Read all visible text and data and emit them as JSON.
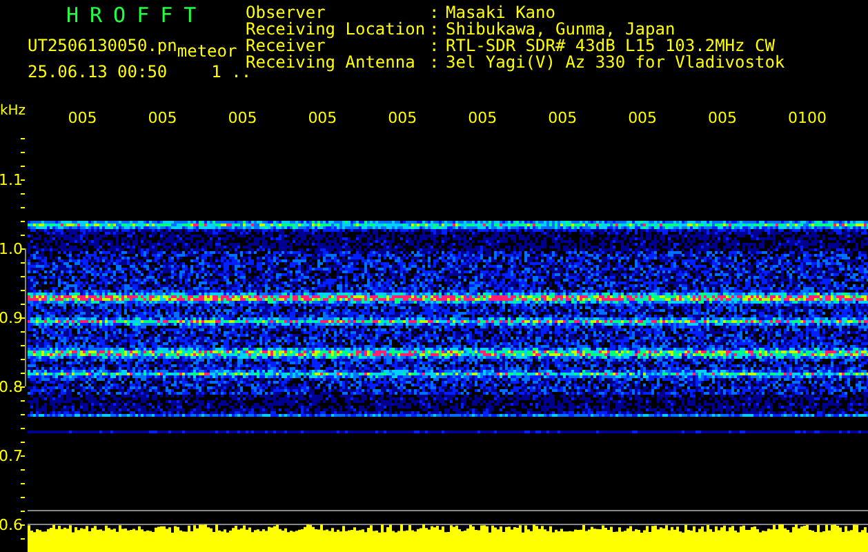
{
  "title": "HROFFT",
  "file_name": "UT2506130050.pn",
  "file_tag": "meteor",
  "timestamp": "25.06.13 00:50",
  "counter": "1 ..",
  "info": [
    {
      "label": "Observer",
      "separator": ":",
      "value": "Masaki Kano"
    },
    {
      "label": "Receiving Location",
      "separator": ":",
      "value": "Shibukawa, Gunma, Japan"
    },
    {
      "label": "Receiver",
      "separator": ":",
      "value": "RTL-SDR SDR# 43dB L15 103.2MHz CW"
    },
    {
      "label": "Receiving Antenna",
      "separator": ":",
      "value": "3el Yagi(V) Az 330 for Vladivostok"
    }
  ],
  "time_axis": [
    "005",
    "005",
    "005",
    "005",
    "005",
    "005",
    "005",
    "005",
    "005",
    "0100"
  ],
  "freq_axis": {
    "unit": "kHz",
    "ticks": [
      "1.1",
      "1.0",
      "0.9",
      "0.8",
      "0.7",
      "0.6"
    ]
  }
}
